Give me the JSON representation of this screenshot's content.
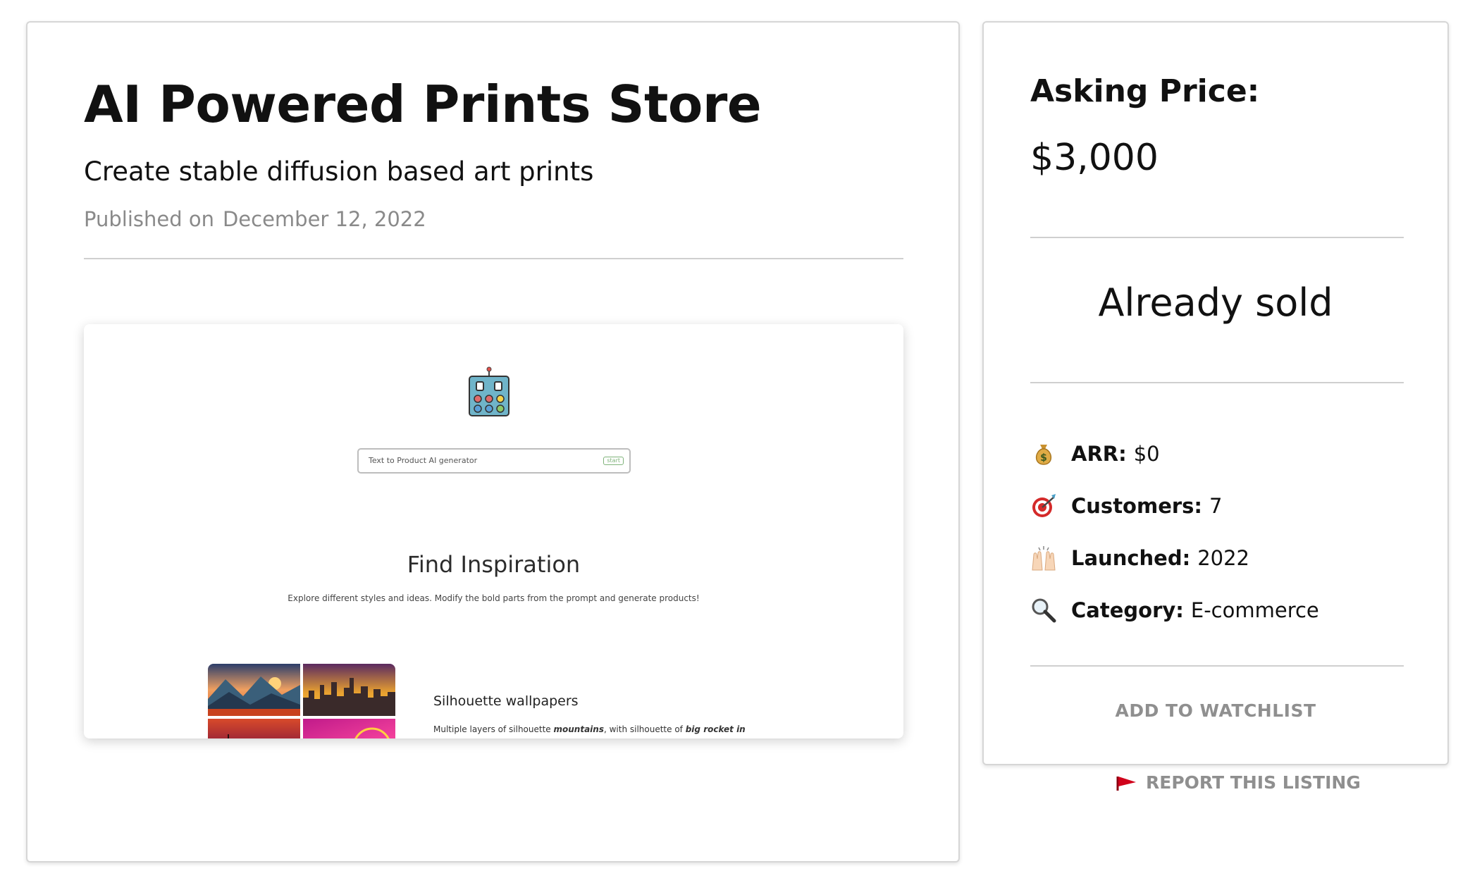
{
  "listing": {
    "title": "AI Powered Prints Store",
    "subtitle": "Create stable diffusion based art prints",
    "published_label": "Published on",
    "published_date": "December 12, 2022"
  },
  "preview": {
    "input_placeholder": "Text to Product AI generator",
    "start_label": "start",
    "find_title": "Find Inspiration",
    "find_subtitle": "Explore different styles and ideas. Modify the bold parts from the prompt and generate products!",
    "example_title": "Silhouette wallpapers",
    "example_desc_1": "Multiple layers of silhouette ",
    "example_desc_bold_1": "mountains",
    "example_desc_2": ", with silhouette of ",
    "example_desc_bold_2": "big rocket in"
  },
  "sidebar": {
    "asking_price_label": "Asking Price:",
    "asking_price_value": "$3,000",
    "status": "Already sold",
    "stats": [
      {
        "icon": "money-bag-icon",
        "label": "ARR:",
        "value": "$0"
      },
      {
        "icon": "target-icon",
        "label": "Customers:",
        "value": "7"
      },
      {
        "icon": "raised-hands-icon",
        "label": "Launched:",
        "value": "2022"
      },
      {
        "icon": "magnifier-icon",
        "label": "Category:",
        "value": "E-commerce"
      }
    ],
    "watchlist_label": "ADD TO WATCHLIST",
    "report_label": "REPORT THIS LISTING"
  },
  "colors": {
    "muted_text": "#8f8f8f",
    "divider": "#cfcfcf",
    "flag_red": "#d0021b"
  }
}
